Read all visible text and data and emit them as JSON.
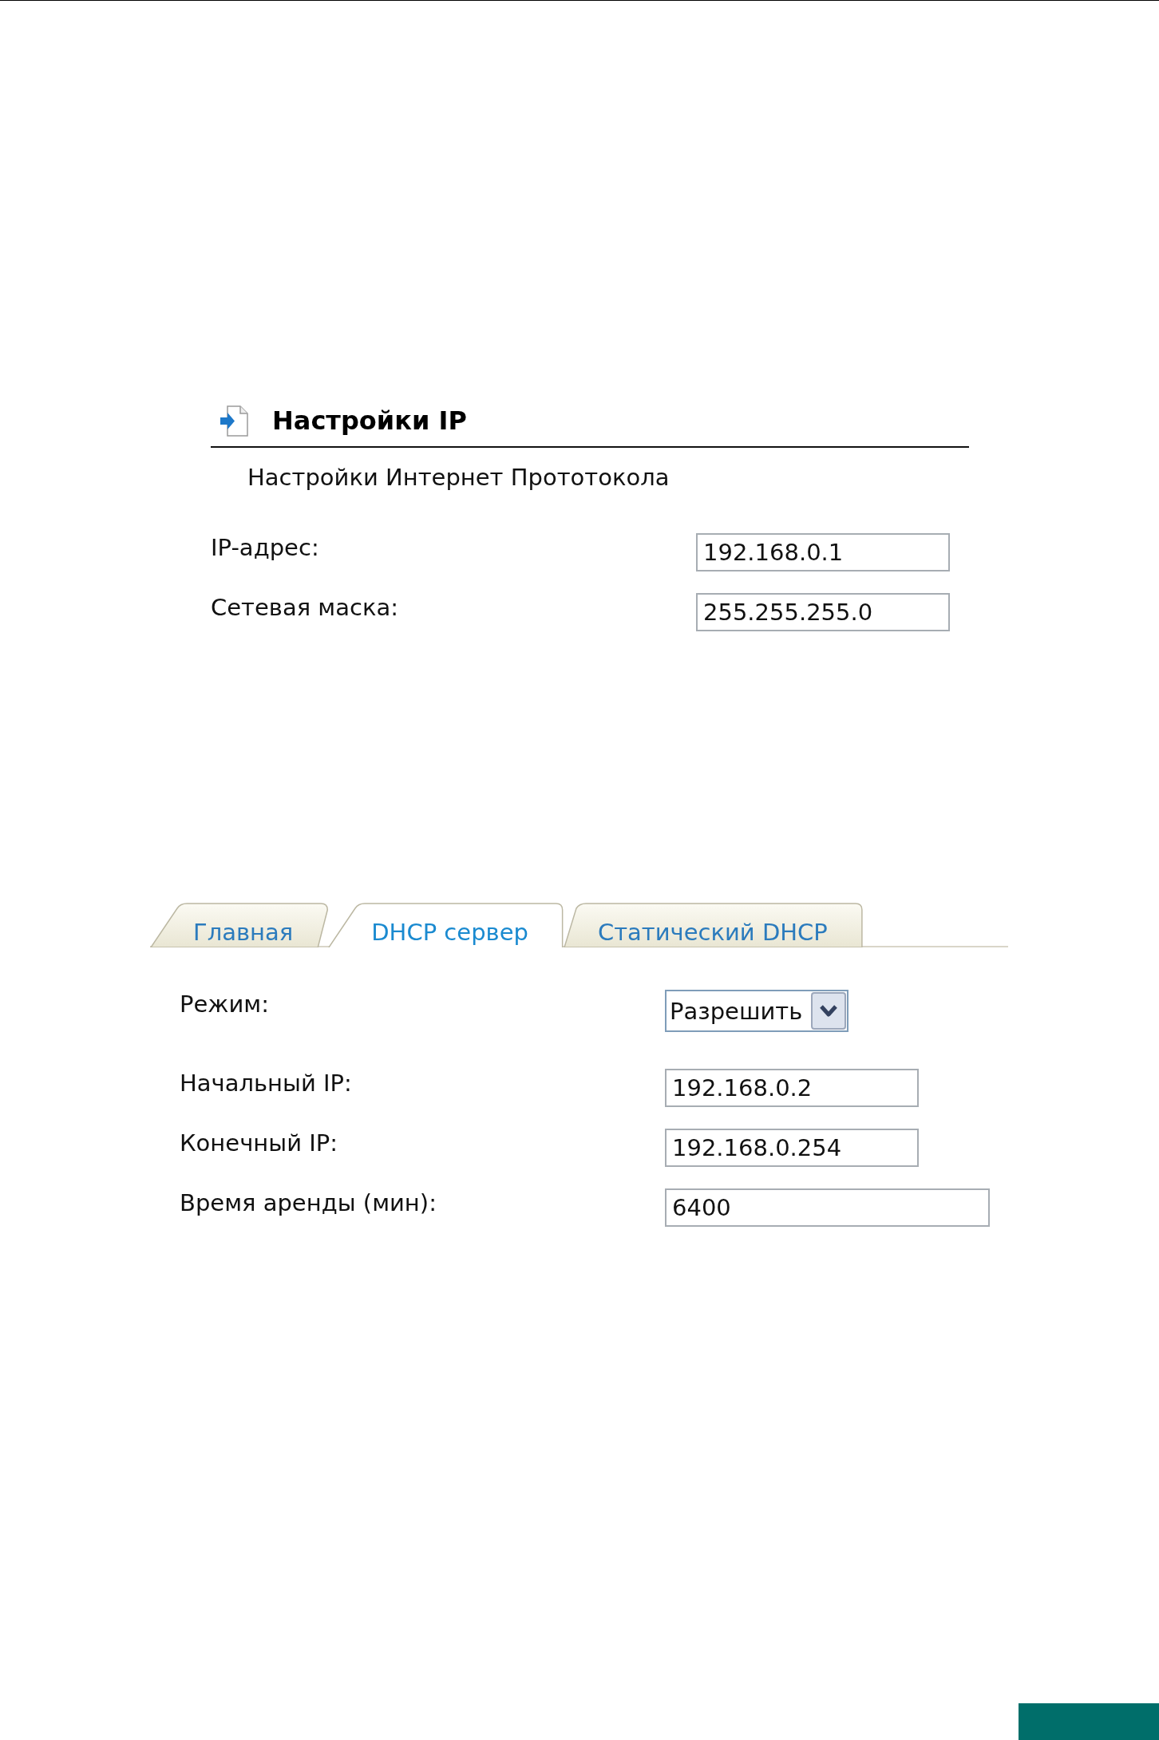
{
  "ip_settings": {
    "title": "Настройки IP",
    "subtitle": "Настройки Интернет Прототокола",
    "fields": [
      {
        "label": "IP-адрес:",
        "value": "192.168.0.1"
      },
      {
        "label": "Сетевая маска:",
        "value": "255.255.255.0"
      }
    ]
  },
  "dhcp": {
    "tabs": [
      {
        "label": "Главная",
        "selected": false
      },
      {
        "label": "DHCP сервер",
        "selected": true
      },
      {
        "label": "Статический DHCP",
        "selected": false
      }
    ],
    "fields": [
      {
        "kind": "select",
        "label": "Режим:",
        "value": "Разрешить"
      },
      {
        "kind": "input",
        "label": "Начальный IP:",
        "value": "192.168.0.2"
      },
      {
        "kind": "input",
        "label": "Конечный IP:",
        "value": "192.168.0.254"
      },
      {
        "kind": "wideinput",
        "label": "Время аренды (мин):",
        "value": "6400"
      }
    ]
  }
}
